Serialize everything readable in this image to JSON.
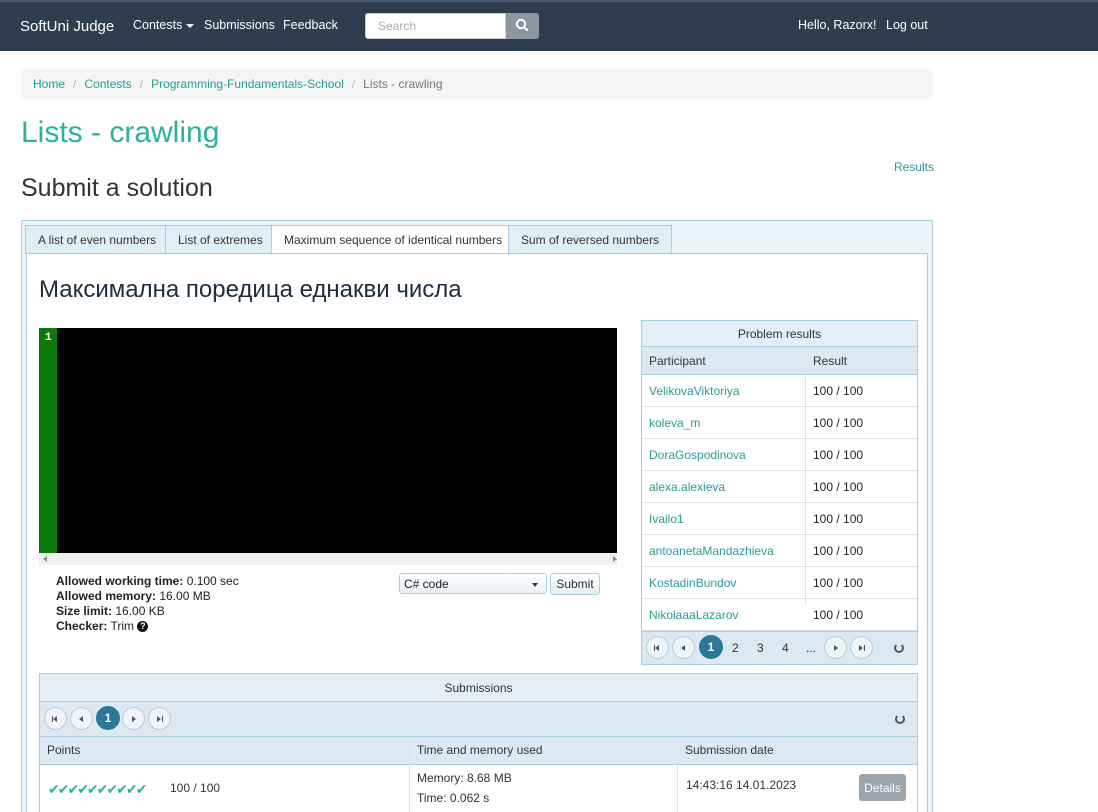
{
  "nav": {
    "brand": "SoftUni Judge",
    "contests": "Contests",
    "submissions": "Submissions",
    "feedback": "Feedback",
    "search_placeholder": "Search",
    "greeting": "Hello, Razorx!",
    "logout": "Log out"
  },
  "breadcrumb": [
    "Home",
    "Contests",
    "Programming-Fundamentals-School",
    "Lists - crawling"
  ],
  "page_title": "Lists - crawling",
  "results_link": "Results",
  "section_title": "Submit a solution",
  "tabs": [
    {
      "label": "A list of even numbers"
    },
    {
      "label": "List of extremes"
    },
    {
      "label": "Maximum sequence of identical numbers",
      "active": true
    },
    {
      "label": "Sum of reversed numbers"
    }
  ],
  "problem_title": "Максимална поредица еднакви числа",
  "editor": {
    "line_number": "1"
  },
  "limits": {
    "time_label": "Allowed working time:",
    "time_value": "0.100 sec",
    "memory_label": "Allowed memory:",
    "memory_value": "16.00 MB",
    "size_label": "Size limit:",
    "size_value": "16.00 KB",
    "checker_label": "Checker:",
    "checker_value": "Trim"
  },
  "language": "C# code",
  "submit_label": "Submit",
  "problem_results": {
    "title": "Problem results",
    "columns": [
      "Participant",
      "Result"
    ],
    "rows": [
      {
        "participant": "VelikovaViktoriya",
        "result": "100 / 100"
      },
      {
        "participant": "koleva_m",
        "result": "100 / 100"
      },
      {
        "participant": "DoraGospodinova",
        "result": "100 / 100"
      },
      {
        "participant": "alexa.alexieva",
        "result": "100 / 100"
      },
      {
        "participant": "Ivailo1",
        "result": "100 / 100"
      },
      {
        "participant": "antoanetaMandazhieva",
        "result": "100 / 100"
      },
      {
        "participant": "KostadinBundov",
        "result": "100 / 100"
      },
      {
        "participant": "NikolaaaLazarov",
        "result": "100 / 100"
      }
    ],
    "pager": {
      "current": "1",
      "pages": [
        "2",
        "3",
        "4",
        "..."
      ]
    }
  },
  "submissions": {
    "title": "Submissions",
    "pager": {
      "current": "1"
    },
    "columns": [
      "Points",
      "Time and memory used",
      "Submission date"
    ],
    "rows": [
      {
        "checks": "✔✔✔✔✔✔✔✔✔✔",
        "points": "100 / 100",
        "memory": "Memory: 8.68 MB",
        "time": "Time: 0.062 s",
        "date": "14:43:16 14.01.2023",
        "details": "Details"
      }
    ]
  }
}
